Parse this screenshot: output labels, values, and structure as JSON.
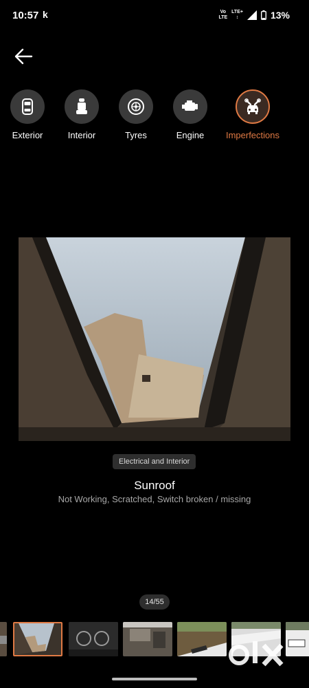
{
  "status_bar": {
    "time": "10:57",
    "app_icon": "k",
    "network_top": "Vo",
    "network_bottom": "LTE",
    "network2_top": "LTE+",
    "battery": "13%",
    "icons": [
      "signal-icon",
      "battery-icon"
    ]
  },
  "nav": {
    "back_icon": "arrow-left-icon"
  },
  "tabs": [
    {
      "label": "Exterior",
      "icon": "car-exterior-icon",
      "active": false
    },
    {
      "label": "Interior",
      "icon": "car-seat-icon",
      "active": false
    },
    {
      "label": "Tyres",
      "icon": "tyre-icon",
      "active": false
    },
    {
      "label": "Engine",
      "icon": "engine-icon",
      "active": false
    },
    {
      "label": "Imperfections",
      "icon": "car-wrench-icon",
      "active": true
    }
  ],
  "detail": {
    "category": "Electrical and Interior",
    "title": "Sunroof",
    "description": "Not Working, Scratched, Switch broken / missing"
  },
  "gallery": {
    "counter": "14/55",
    "thumbnails": [
      "sunroof-thumb",
      "dashboard-thumb",
      "engine-bay-thumb",
      "roof-thumb",
      "hood-thumb",
      "front-bumper-thumb"
    ],
    "watermark_text": "olx"
  },
  "colors": {
    "accent": "#e07a44",
    "background": "#000000",
    "chip": "#2e2e2e"
  }
}
